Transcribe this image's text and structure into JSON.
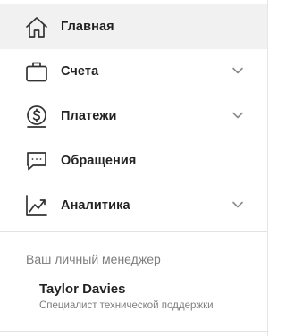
{
  "nav": {
    "items": [
      {
        "label": "Главная",
        "icon": "home-icon",
        "active": true,
        "expandable": false
      },
      {
        "label": "Счета",
        "icon": "briefcase-icon",
        "active": false,
        "expandable": true
      },
      {
        "label": "Платежи",
        "icon": "dollar-coin-icon",
        "active": false,
        "expandable": true
      },
      {
        "label": "Обращения",
        "icon": "chat-bubble-icon",
        "active": false,
        "expandable": false
      },
      {
        "label": "Аналитика",
        "icon": "chart-icon",
        "active": false,
        "expandable": true
      }
    ]
  },
  "manager": {
    "heading": "Ваш личный менеджер",
    "name": "Taylor Davies",
    "role": "Специалист технической поддержки"
  },
  "colors": {
    "active_bg": "#f1f1f1",
    "icon": "#333333",
    "chevron": "#8a8a8a",
    "muted_text": "#7d7d7d"
  }
}
